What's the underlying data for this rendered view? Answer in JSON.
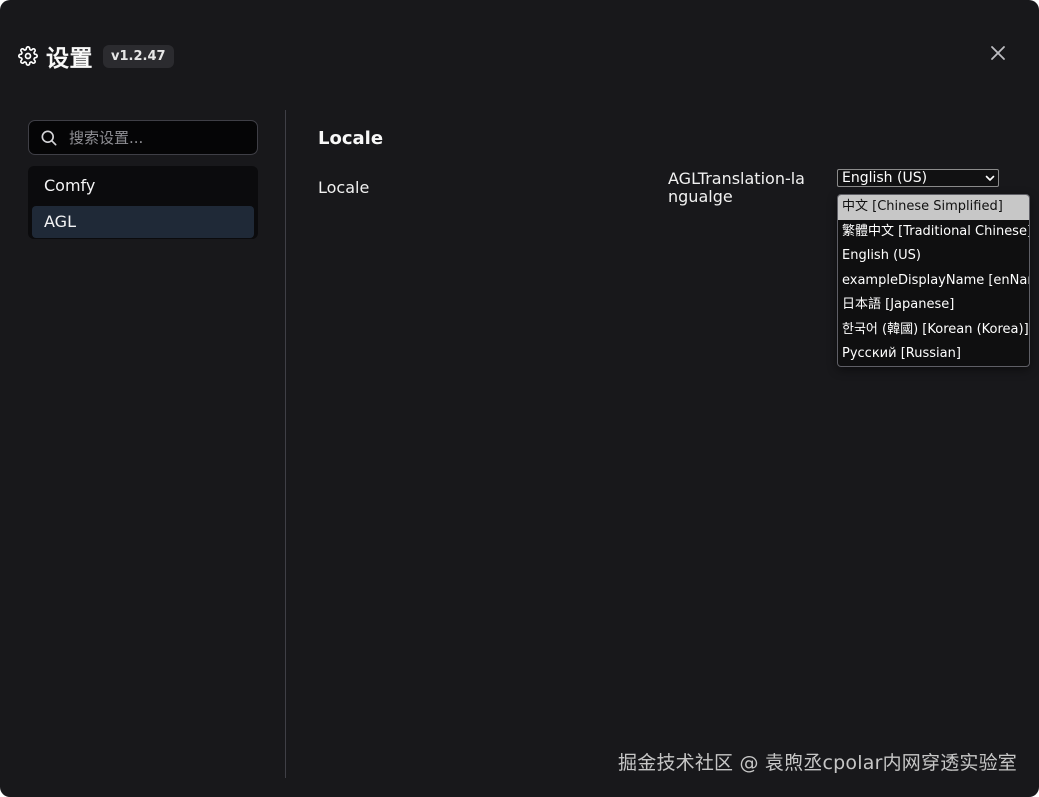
{
  "header": {
    "title": "设置",
    "version": "v1.2.47"
  },
  "sidebar": {
    "search_placeholder": "搜索设置...",
    "items": [
      {
        "label": "Comfy"
      },
      {
        "label": "AGL"
      }
    ]
  },
  "main": {
    "section_title": "Locale",
    "setting_label": "Locale",
    "setting_name": "AGLTranslation-langualge",
    "selected_value": "English (US)",
    "options": [
      "中文 [Chinese Simplified]",
      "繁體中文 [Traditional Chinese]",
      "English (US)",
      "exampleDisplayName [enName]",
      "日本語 [Japanese]",
      "한국어 (韓國) [Korean (Korea)]",
      "Русский [Russian]"
    ]
  },
  "watermark": "掘金技术社区 @ 袁煦丞cpolar内网穿透实验室",
  "icons": {
    "settings": "gear-icon",
    "close": "close-icon",
    "search": "search-icon",
    "dropdown": "chevron-down-icon"
  },
  "colors": {
    "background": "#18181b",
    "sidebar_active": "#1f2937",
    "dropdown_highlight": "#c7c7c7"
  }
}
